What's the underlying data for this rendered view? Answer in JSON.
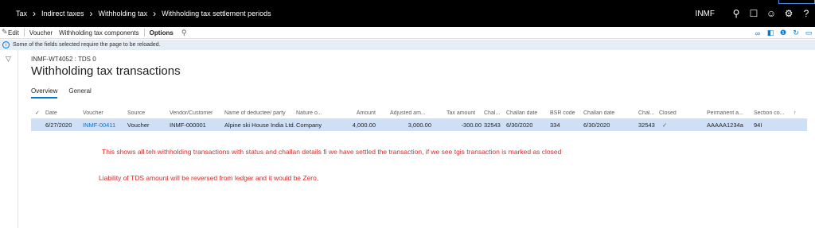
{
  "breadcrumb": [
    "Tax",
    "Indirect taxes",
    "Withholding tax",
    "Withholding tax settlement periods"
  ],
  "topbar": {
    "company": "INMF"
  },
  "actions": {
    "edit": "Edit",
    "voucher": "Voucher",
    "wht_components": "Withholding tax components",
    "options": "Options"
  },
  "infobar": {
    "message": "Some of the fields selected require the page to be reloaded."
  },
  "header": {
    "record_id": "INMF-WT4052 : TDS 0",
    "title": "Withholding tax transactions"
  },
  "tabs": [
    "Overview",
    "General"
  ],
  "grid": {
    "columns": [
      "Date",
      "Voucher",
      "Source",
      "Vendor/Customer",
      "Name of deductee/ party",
      "Nature o...",
      "Amount",
      "Adjusted am...",
      "Tax amount",
      "Chal...",
      "Challan date",
      "BSR code",
      "Challan date",
      "Chal...",
      "Closed",
      "Permanent a...",
      "Section co..."
    ],
    "row": {
      "date": "6/27/2020",
      "voucher": "INMF-00411",
      "source": "Voucher",
      "vendor": "INMF-000001",
      "name": "Alpine ski House India Ltd.",
      "nature": "Company",
      "amount": "4,000.00",
      "adjusted": "3,000.00",
      "tax": "-300.00",
      "chal1": "32543",
      "challan_date1": "6/30/2020",
      "bsr": "334",
      "challan_date2": "6/30/2020",
      "chal2": "32543",
      "closed": "✓",
      "pan": "AAAAA1234a",
      "section": "94I"
    }
  },
  "notes": [
    "This shows all teh withholding transactions with status and challan details fi we have settled the transaction, if we see tgis transaction is marked as closed",
    "Liability of TDS amount will be reversed from ledger and it would be Zero,"
  ]
}
